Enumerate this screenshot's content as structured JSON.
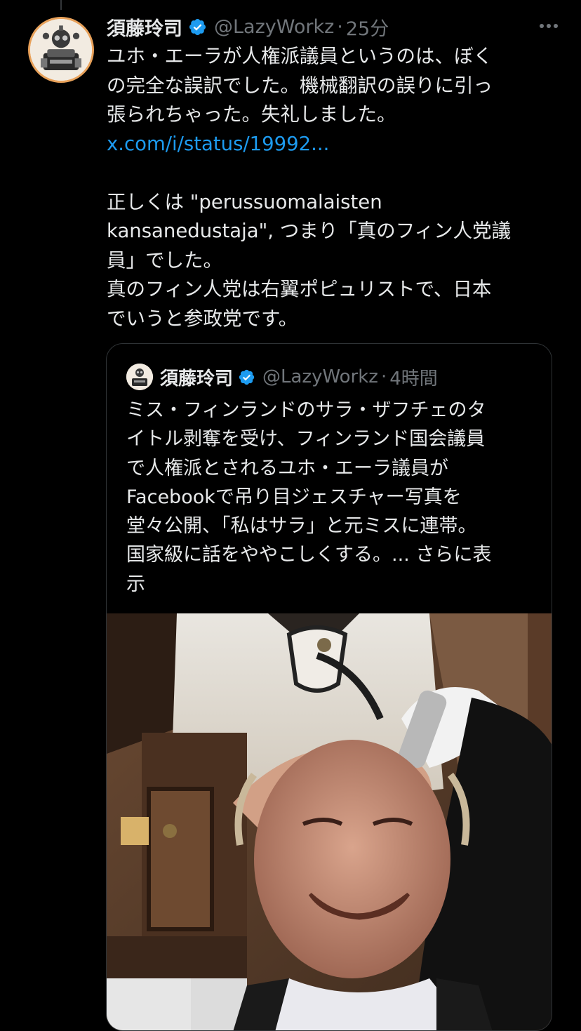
{
  "tweet": {
    "author": {
      "display_name": "須藤玲司",
      "handle": "@LazyWorkz",
      "avatar_icon": "robot-avatar"
    },
    "timestamp": "25分",
    "separator": "·",
    "text_lines": [
      "ユホ・エーラが人権派議員というのは、ぼく",
      "の完全な誤訳でした。機械翻訳の誤りに引っ",
      "張られちゃった。失礼しました。"
    ],
    "link": "x.com/i/status/19992...",
    "text_lines_2": [
      "正しくは \"perussuomalaisten",
      "kansanedustaja\", つまり「真のフィン人党議",
      "員」でした。",
      "真のフィン人党は右翼ポピュリストで、日本",
      "でいうと参政党です。"
    ]
  },
  "quote": {
    "author": {
      "display_name": "須藤玲司",
      "handle": "@LazyWorkz",
      "avatar_icon": "robot-avatar"
    },
    "timestamp": "4時間",
    "separator": "·",
    "text_lines": [
      "ミス・フィンランドのサラ・ザフチェのタ",
      "イトル剥奪を受け、フィンランド国会議員",
      "で人権派とされるユホ・エーラ議員が",
      "Facebookで吊り目ジェスチャー写真を",
      "堂々公開、「私はサラ」と元ミスに連帯。",
      "国家級に話をややこしくする。... さらに表"
    ],
    "last_line_prefix": "",
    "show_more_tail": "示",
    "media_icon": "photo-thumbnail"
  },
  "colors": {
    "background": "#000000",
    "text": "#e7e9ea",
    "muted": "#71767b",
    "link": "#1d9bf0",
    "verified": "#1d9bf0",
    "border": "#2f3336"
  }
}
